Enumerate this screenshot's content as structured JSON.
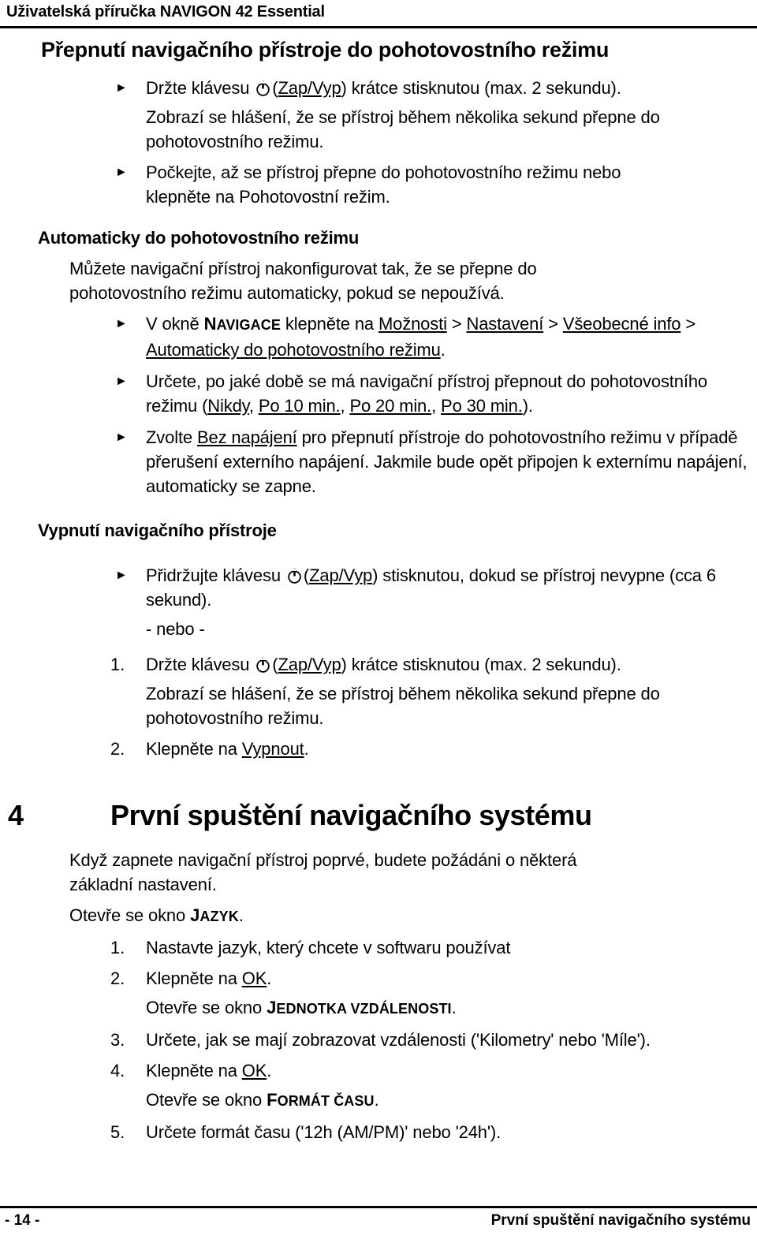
{
  "header": {
    "running_title": "Uživatelská příručka NAVIGON 42 Essential"
  },
  "footer": {
    "page_number": "- 14 -",
    "chapter_title": "První spuštění navigačního systému"
  },
  "section_standby": {
    "heading": "Přepnutí navigačního přístroje do pohotovostního režimu",
    "bullet1": {
      "before_icon": "Držte klávesu ",
      "icon": "power-icon",
      "paren_open": "(",
      "link": "Zap/Vyp",
      "paren_close": ") ",
      "after": "krátce stisknutou (max. 2 sekundu)."
    },
    "bullet1_note_line1": "Zobrazí se hlášení, že se přístroj během několika sekund přepne do",
    "bullet1_note_line2": "pohotovostního režimu.",
    "bullet2_line1": "Počkejte, až se přístroj přepne do pohotovostního režimu nebo",
    "bullet2_line2": "klepněte na Pohotovostní režim."
  },
  "section_auto": {
    "heading": "Automaticky do pohotovostního režimu",
    "para_line1": "Můžete navigační přístroj nakonfigurovat tak, že se přepne do",
    "para_line2": "pohotovostního režimu automaticky, pokud se nepoužívá.",
    "bullet1": {
      "p1": "V okně ",
      "smallcaps": "Navigace",
      "p2": " klepněte na ",
      "l1": "Možnosti",
      "sep1": " > ",
      "l2": "Nastavení",
      "sep2": " > ",
      "l3": "Všeobecné info",
      "sep3": " > ",
      "l4": "Automaticky do pohotovostního režimu",
      "end": "."
    },
    "bullet2": {
      "p1": "Určete, po jaké době se má navigační přístroj přepnout do pohotovostního režimu (",
      "o1": "Nikdy",
      "c1": ", ",
      "o2": "Po 10 min.",
      "c2": ", ",
      "o3": "Po 20 min.",
      "c3": ", ",
      "o4": "Po 30 min.",
      "end": ")."
    },
    "bullet3": {
      "p1": "Zvolte ",
      "l1": "Bez napájení",
      "p2": " pro přepnutí přístroje do pohotovostního režimu v případě přerušení externího napájení. Jakmile bude opět připojen k externímu napájení, automaticky se zapne."
    }
  },
  "section_off": {
    "heading": "Vypnutí navigačního přístroje",
    "bullet1": {
      "before_icon": "Přidržujte klávesu ",
      "icon": "power-icon",
      "paren_open": "(",
      "link": "Zap/Vyp",
      "paren_close": ") ",
      "after": "stisknutou, dokud se přístroj nevypne (cca 6 sekund)."
    },
    "or_text": "- nebo -",
    "steps": [
      {
        "num": "1.",
        "before_icon": "Držte klávesu ",
        "icon": "power-icon",
        "paren_open": "(",
        "link": "Zap/Vyp",
        "paren_close": ") ",
        "after": "krátce stisknutou (max. 2 sekundu).",
        "note_line1": "Zobrazí se hlášení, že se přístroj během několika sekund přepne do",
        "note_line2": "pohotovostního režimu."
      },
      {
        "num": "2.",
        "before_link": "Klepněte na ",
        "link": "Vypnout",
        "after": "."
      }
    ]
  },
  "chapter": {
    "number": "4",
    "title": "První spuštění navigačního systému",
    "intro_line1": "Když zapnete navigační přístroj poprvé, budete požádáni o některá",
    "intro_line2": "základní nastavení.",
    "window_line": {
      "prefix": "Otevře se okno ",
      "smallcaps": "Jazyk",
      "suffix": "."
    },
    "steps": [
      {
        "num": "1.",
        "text": "Nastavte jazyk, který chcete v softwaru používat"
      },
      {
        "num": "2.",
        "before_link": "Klepněte na ",
        "link": "OK",
        "after": "."
      },
      {
        "num": "",
        "window_prefix": "Otevře se okno ",
        "window_smallcaps": "Jednotka vzdálenosti",
        "window_suffix": "."
      },
      {
        "num": "3.",
        "text": "Určete, jak se mají zobrazovat vzdálenosti ('Kilometry' nebo 'Míle')."
      },
      {
        "num": "4.",
        "before_link": "Klepněte na ",
        "link": "OK",
        "after": "."
      },
      {
        "num": "",
        "window_prefix": "Otevře se okno ",
        "window_smallcaps": "Formát času",
        "window_suffix": "."
      },
      {
        "num": "5.",
        "text": "Určete formát času ('12h (AM/PM)' nebo '24h')."
      }
    ]
  },
  "colors": {
    "text": "#000000",
    "background": "#ffffff",
    "rule": "#000000"
  }
}
